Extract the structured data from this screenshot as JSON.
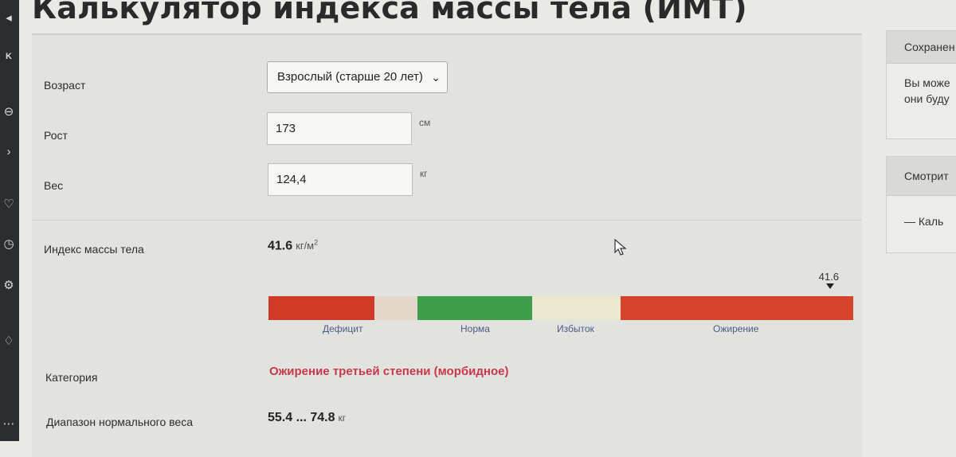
{
  "page": {
    "title": "Калькулятор индекса массы тела (ИМТ)"
  },
  "form": {
    "age": {
      "label": "Возраст",
      "value": "Взрослый (старше 20 лет)"
    },
    "height": {
      "label": "Рост",
      "value": "173",
      "unit": "см"
    },
    "weight": {
      "label": "Вес",
      "value": "124,4",
      "unit": "кг"
    }
  },
  "result": {
    "bmi_label": "Индекс массы тела",
    "bmi_value": "41.6",
    "bmi_unit": "кг/м",
    "bmi_unit_sup": "2",
    "scale": {
      "marker_label": "41.6",
      "marker_fraction": 0.96,
      "segments": [
        {
          "label": "Дефицит",
          "color": "#cf3b27"
        },
        {
          "label": "",
          "color": "#e3d7c9"
        },
        {
          "label": "Норма",
          "color": "#3f9e4a"
        },
        {
          "label": "Избыток",
          "color": "#e9e8cf"
        },
        {
          "label": "Ожирение",
          "color": "#d6432c"
        }
      ]
    },
    "category_label": "Категория",
    "category_value": "Ожирение третьей степени (морбидное)",
    "range_label": "Диапазон нормального веса",
    "range_value": "55.4 ... 74.8",
    "range_unit": "кг"
  },
  "sidebar": {
    "card1": {
      "title": "Сохранен",
      "line1": "Вы може",
      "line2": "они буду"
    },
    "card2": {
      "title": "Смотрит",
      "item": "— Каль"
    }
  },
  "rail": {
    "icons": [
      "circle-arrow-icon",
      "vk-icon",
      "arrow-right-icon",
      "play-icon",
      "heart-icon",
      "clock-icon",
      "gear-icon",
      "bulb-icon",
      "more-icon"
    ]
  },
  "colors": {
    "category": "#c7384a",
    "link_labels": "#4a5a8a"
  }
}
